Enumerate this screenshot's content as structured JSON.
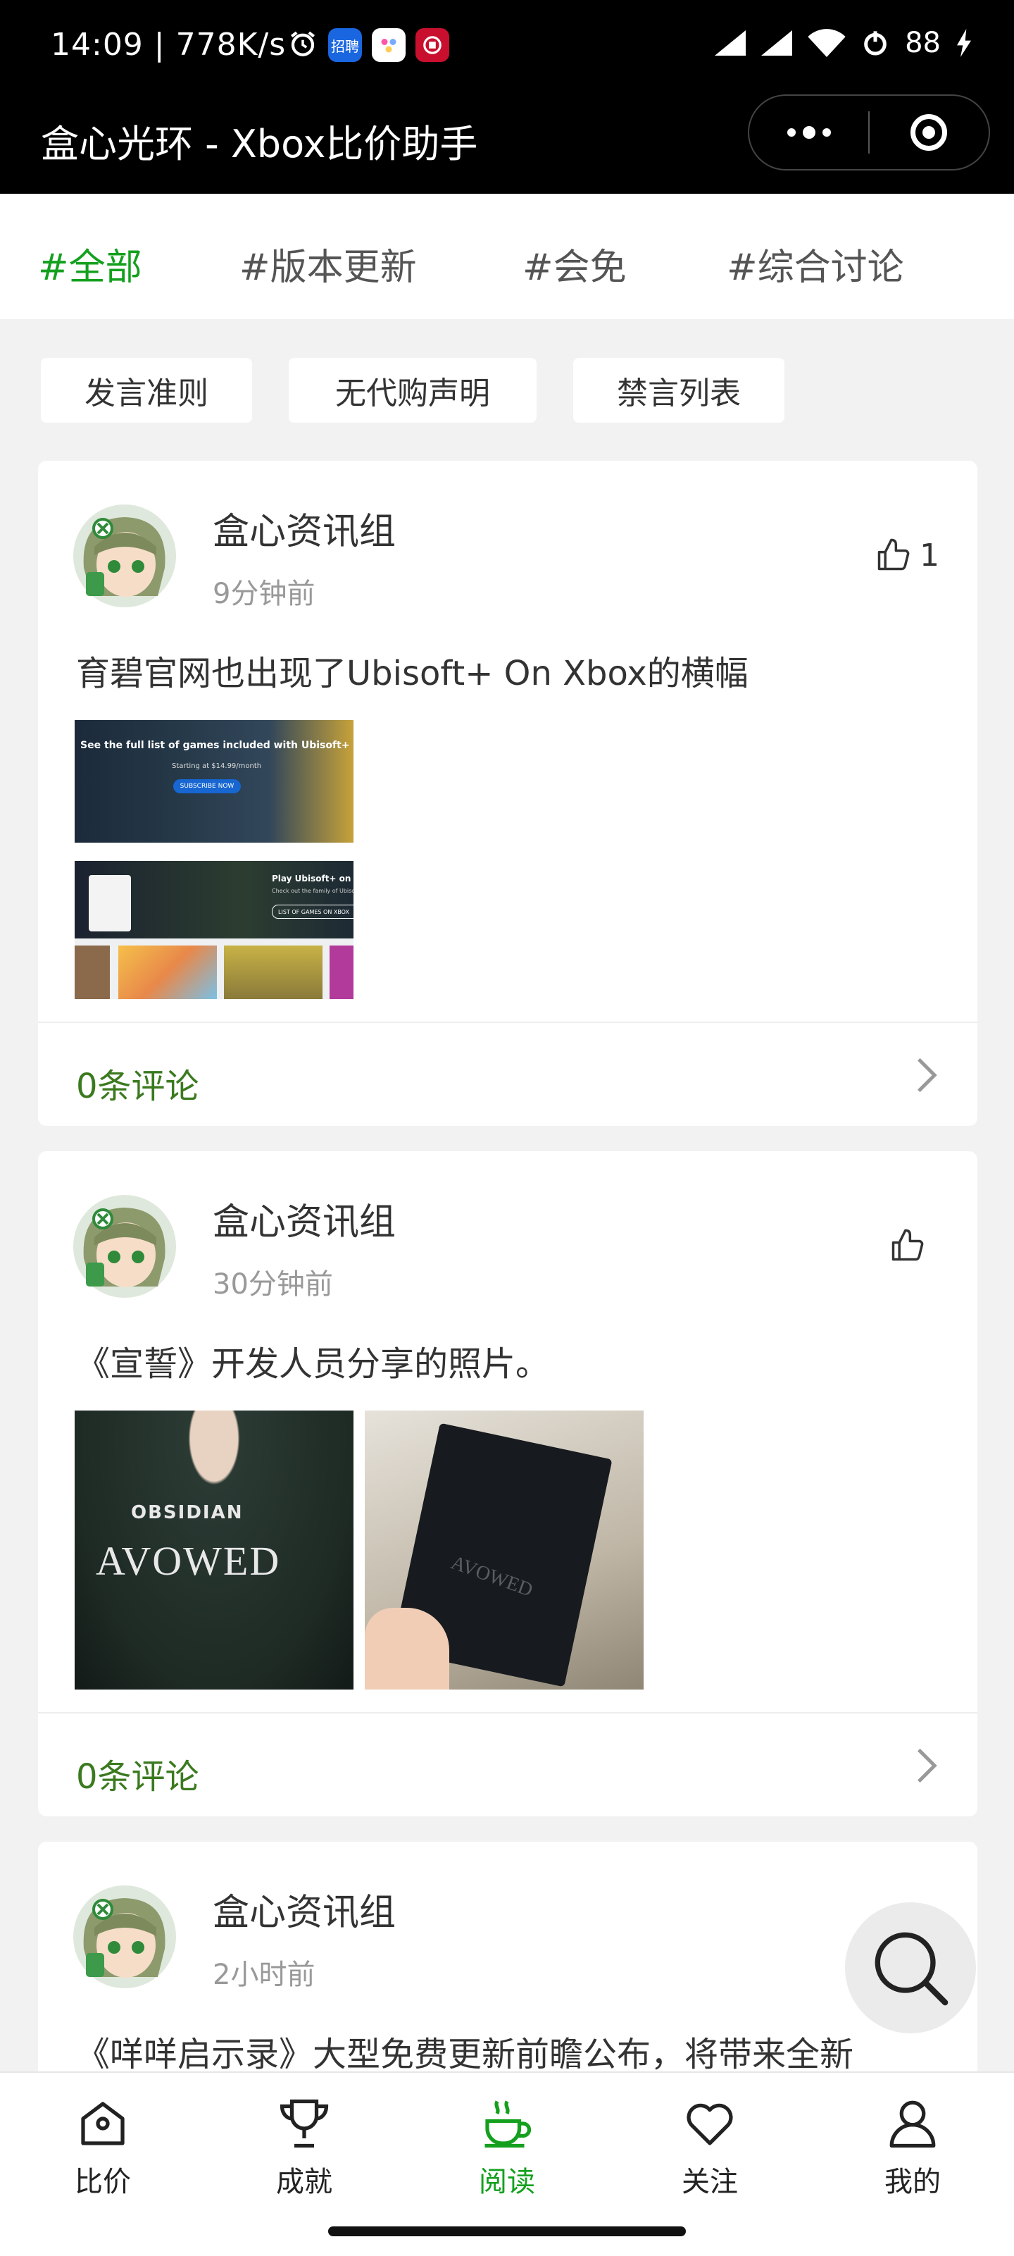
{
  "status_bar": {
    "time": "14:09 | 778K/s",
    "app_badge": "招聘",
    "battery": "88"
  },
  "header": {
    "title": "盒心光环 - Xbox比价助手"
  },
  "tabs": [
    {
      "label": "#全部",
      "active": true
    },
    {
      "label": "#版本更新",
      "active": false
    },
    {
      "label": "#会免",
      "active": false
    },
    {
      "label": "#综合讨论",
      "active": false
    }
  ],
  "rule_chips": [
    "发言准则",
    "无代购声明",
    "禁言列表"
  ],
  "posts": [
    {
      "author": "盒心资讯组",
      "time": "9分钟前",
      "likes": "1",
      "text": "育碧官网也出现了Ubisoft+ On Xbox的横幅",
      "images": [
        {
          "caption": "See the full list of games included with Ubisoft+",
          "sub": "Starting at $14.99/month",
          "button": "SUBSCRIBE NOW"
        },
        {
          "caption": "Play Ubisoft+ on Xbox",
          "sub": "Check out the family of Ubisoft games",
          "button": "LIST OF GAMES ON XBOX"
        }
      ],
      "comments": "0条评论"
    },
    {
      "author": "盒心资讯组",
      "time": "30分钟前",
      "likes": "",
      "text": "《宣誓》开发人员分享的照片。",
      "images": [
        {
          "caption": "OBSIDIAN",
          "sub": "AVOWED"
        },
        {
          "caption": "AVOWED"
        }
      ],
      "comments": "0条评论"
    },
    {
      "author": "盒心资讯组",
      "time": "2小时前",
      "text": "《咩咩启示录》大型免费更新前瞻公布，将带来全新"
    }
  ],
  "bottom_nav": [
    {
      "label": "比价",
      "icon": "house-tag-icon",
      "active": false
    },
    {
      "label": "成就",
      "icon": "trophy-icon",
      "active": false
    },
    {
      "label": "阅读",
      "icon": "coffee-cup-icon",
      "active": true
    },
    {
      "label": "关注",
      "icon": "heart-icon",
      "active": false
    },
    {
      "label": "我的",
      "icon": "person-icon",
      "active": false
    }
  ],
  "colors": {
    "accent": "#14a01e",
    "comment_green": "#3b7a1f",
    "header_bg": "#000000",
    "page_bg": "#f2f2f2"
  }
}
